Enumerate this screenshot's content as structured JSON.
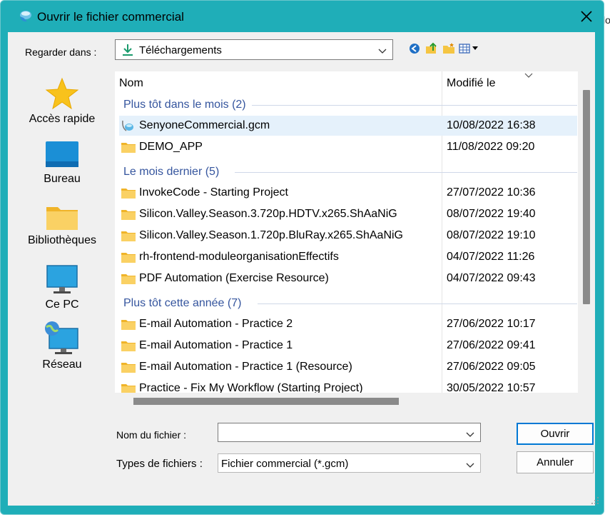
{
  "window": {
    "title": "Ouvrir le fichier commercial"
  },
  "background": {
    "cut_text": "lo"
  },
  "look_in": {
    "label": "Regarder dans :",
    "value": "Téléchargements"
  },
  "places": [
    {
      "label": "Accès rapide",
      "icon": "star-icon"
    },
    {
      "label": "Bureau",
      "icon": "desktop-icon"
    },
    {
      "label": "Bibliothèques",
      "icon": "library-icon"
    },
    {
      "label": "Ce PC",
      "icon": "computer-icon"
    },
    {
      "label": "Réseau",
      "icon": "network-icon"
    }
  ],
  "columns": {
    "name": "Nom",
    "modified": "Modifié le"
  },
  "groups": [
    {
      "label": "Plus tôt dans le mois (2)",
      "items": [
        {
          "name": "SenyoneCommercial.gcm",
          "date": "10/08/2022 16:38",
          "type": "gcm-file",
          "selected": true
        },
        {
          "name": "DEMO_APP",
          "date": "11/08/2022 09:20",
          "type": "folder"
        }
      ]
    },
    {
      "label": "Le mois dernier (5)",
      "items": [
        {
          "name": "InvokeCode - Starting Project",
          "date": "27/07/2022 10:36",
          "type": "folder"
        },
        {
          "name": "Silicon.Valley.Season.3.720p.HDTV.x265.ShAaNiG",
          "date": "08/07/2022 19:40",
          "type": "folder"
        },
        {
          "name": "Silicon.Valley.Season.1.720p.BluRay.x265.ShAaNiG",
          "date": "08/07/2022 19:10",
          "type": "folder"
        },
        {
          "name": "rh-frontend-moduleorganisationEffectifs",
          "date": "04/07/2022 11:26",
          "type": "folder"
        },
        {
          "name": "PDF Automation (Exercise Resource)",
          "date": "04/07/2022 09:43",
          "type": "folder"
        }
      ]
    },
    {
      "label": "Plus tôt cette année (7)",
      "items": [
        {
          "name": "E-mail Automation - Practice 2",
          "date": "27/06/2022 10:17",
          "type": "folder"
        },
        {
          "name": "E-mail Automation - Practice 1",
          "date": "27/06/2022 09:41",
          "type": "folder"
        },
        {
          "name": "E-mail Automation - Practice 1 (Resource)",
          "date": "27/06/2022 09:05",
          "type": "folder"
        },
        {
          "name": "Practice - Fix My Workflow (Starting Project)",
          "date": "30/05/2022 10:57",
          "type": "folder"
        }
      ]
    }
  ],
  "filename": {
    "label": "Nom du fichier :",
    "value": ""
  },
  "filetype": {
    "label": "Types de fichiers :",
    "value": "Fichier commercial (*.gcm)"
  },
  "buttons": {
    "open": "Ouvrir",
    "cancel": "Annuler"
  },
  "colors": {
    "title_bar": "#1faeb8",
    "group_header": "#35559e",
    "selection": "#e5f1fb",
    "folder": "#f5c542"
  }
}
